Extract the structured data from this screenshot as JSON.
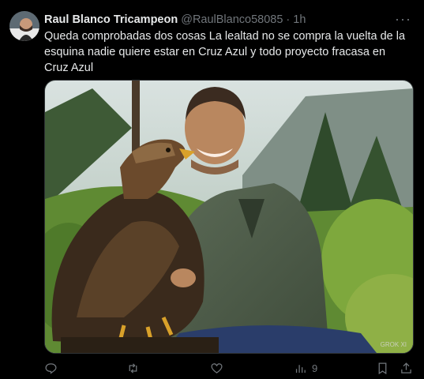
{
  "author": {
    "name": "Raul Blanco Tricampeon",
    "handle": "@RaulBlanco58085",
    "separator": "·",
    "time": "1h"
  },
  "more_menu": "···",
  "tweet_text": "Queda comprobadas dos cosas La lealtad no se compra la vuelta de la esquina nadie quiere estar en Cruz Azul y todo proyecto fracasa en Cruz Azul",
  "media": {
    "watermark": "GROK XI"
  },
  "actions": {
    "reply_icon": "reply-icon",
    "retweet_icon": "retweet-icon",
    "like_icon": "heart-icon",
    "views_icon": "views-chart-icon",
    "views_count": "9",
    "bookmark_icon": "bookmark-icon",
    "share_icon": "share-icon"
  },
  "colors": {
    "background": "#000000",
    "text": "#e7e9ea",
    "secondary": "#71767b"
  }
}
